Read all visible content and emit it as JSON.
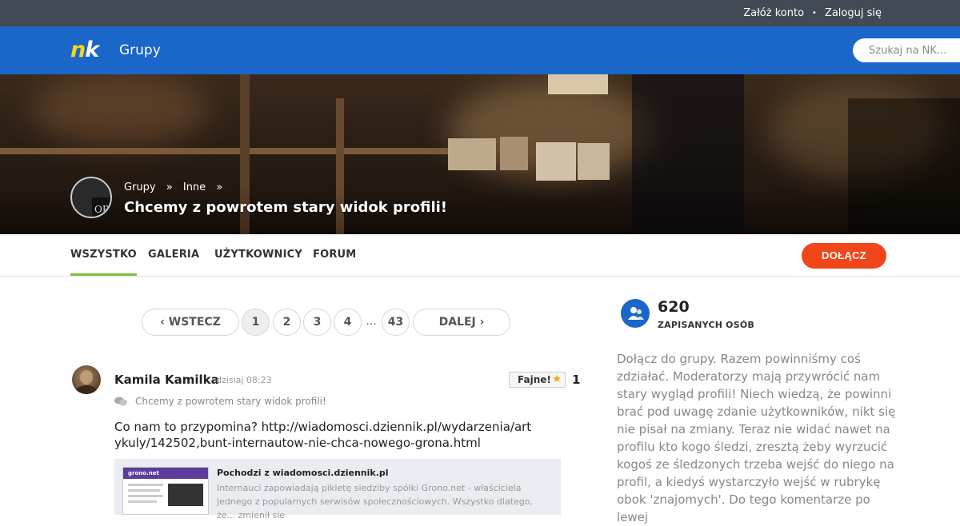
{
  "topbar": {
    "register": "Załóż konto",
    "separator": "•",
    "login": "Zaloguj się"
  },
  "header": {
    "logo_n": "n",
    "logo_k": "k",
    "section": "Grupy",
    "search_placeholder": "Szukaj na NK..."
  },
  "banner": {
    "avatar_badge": "OP",
    "breadcrumb": [
      {
        "label": "Grupy"
      },
      {
        "label": "Inne"
      }
    ],
    "breadcrumb_sep": "»",
    "title": "Chcemy z powrotem stary widok profili!"
  },
  "tabs": [
    {
      "label": "WSZYSTKO",
      "active": true
    },
    {
      "label": "GALERIA"
    },
    {
      "label": "UŻYTKOWNICY"
    },
    {
      "label": "FORUM"
    }
  ],
  "join_button": "DOŁĄCZ",
  "pagination": {
    "prev": "‹ WSTECZ",
    "pages": [
      "1",
      "2",
      "3",
      "4"
    ],
    "ellipsis": "...",
    "last": "43",
    "next": "DALEJ ›",
    "current": "1"
  },
  "post": {
    "author": "Kamila Kamilka",
    "time": "dzisiaj 08:23",
    "like_label": "Fajne!",
    "like_count": "1",
    "topic": "Chcemy z powrotem stary widok profili!",
    "body": "Co nam to przypomina? http://wiadomosci.dziennik.pl/wydarzenia/artykuly/142502,bunt-internautow-nie-chca-nowego-grona.html",
    "link_card": {
      "thumb_brand": "grono.net",
      "title": "Pochodzi z wiadomosci.dziennik.pl",
      "description": "Internauci zapowiadają pikietę siedziby spółki Grono.net - właściciela jednego z popularnych serwisów społecznościowych. Wszystko dlatego, że... zmienił sie"
    }
  },
  "sidebar": {
    "members_count": "620",
    "members_label": "ZAPISANYCH OSÓB",
    "description": "Dołącz do grupy. Razem powinniśmy coś zdziałać. Moderatorzy mają przywrócić nam stary wygląd profili! Niech wiedzą, że powinni brać pod uwagę zdanie użytkowników, nikt się nie pisał na zmiany. Teraz nie widać nawet na profilu kto kogo śledzi, zresztą żeby wyrzucić kogoś ze śledzonych trzeba wejść do niego na profil, a kiedyś wystarczyło wejść w rubrykę obok 'znajomych'. Do tego komentarze po lewej"
  },
  "colors": {
    "topbar": "#414a55",
    "header": "#1a66c9",
    "logo_accent": "#f7d417",
    "join_button": "#f0461a",
    "active_tab_underline": "#7bbf3a",
    "like_star": "#f2a900"
  }
}
